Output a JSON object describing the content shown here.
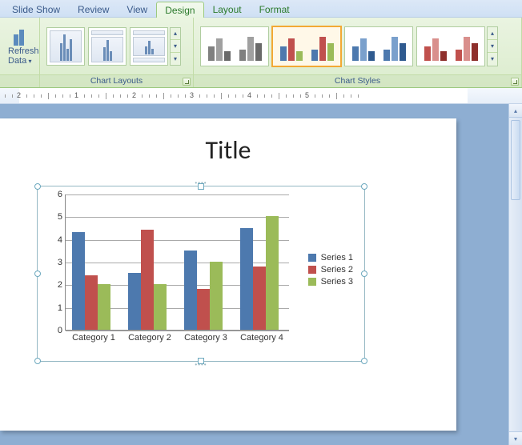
{
  "tabs": [
    "Slide Show",
    "Review",
    "View",
    "Design",
    "Layout",
    "Format"
  ],
  "active_tab_index": 3,
  "ribbon": {
    "refresh_label": "Refresh Data",
    "group_layouts": "Chart Layouts",
    "group_styles": "Chart Styles",
    "style_colors": {
      "gray": [
        "#808080",
        "#a0a0a0",
        "#6a6a6a"
      ],
      "color": [
        "#4d79ae",
        "#c0504d",
        "#9bbb59"
      ],
      "blue": [
        "#4d79ae",
        "#7aa0cc",
        "#2f5a8f"
      ],
      "red": [
        "#c0504d",
        "#d98f8c",
        "#8e2f2c"
      ]
    },
    "selected_style_index": 1
  },
  "ruler": {
    "values": [
      "0",
      "1",
      "2",
      "1",
      "2",
      "3",
      "4",
      "5"
    ],
    "origin_index": 2
  },
  "slide": {
    "title": "Title"
  },
  "chart_data": {
    "type": "bar",
    "title": "",
    "xlabel": "",
    "ylabel": "",
    "ylim": [
      0,
      6
    ],
    "yticks": [
      0,
      1,
      2,
      3,
      4,
      5,
      6
    ],
    "categories": [
      "Category 1",
      "Category 2",
      "Category 3",
      "Category 4"
    ],
    "series": [
      {
        "name": "Series 1",
        "color": "#4d79ae",
        "values": [
          4.3,
          2.5,
          3.5,
          4.5
        ]
      },
      {
        "name": "Series 2",
        "color": "#c0504d",
        "values": [
          2.4,
          4.4,
          1.8,
          2.8
        ]
      },
      {
        "name": "Series 3",
        "color": "#9bbb59",
        "values": [
          2.0,
          2.0,
          3.0,
          5.0
        ]
      }
    ]
  }
}
